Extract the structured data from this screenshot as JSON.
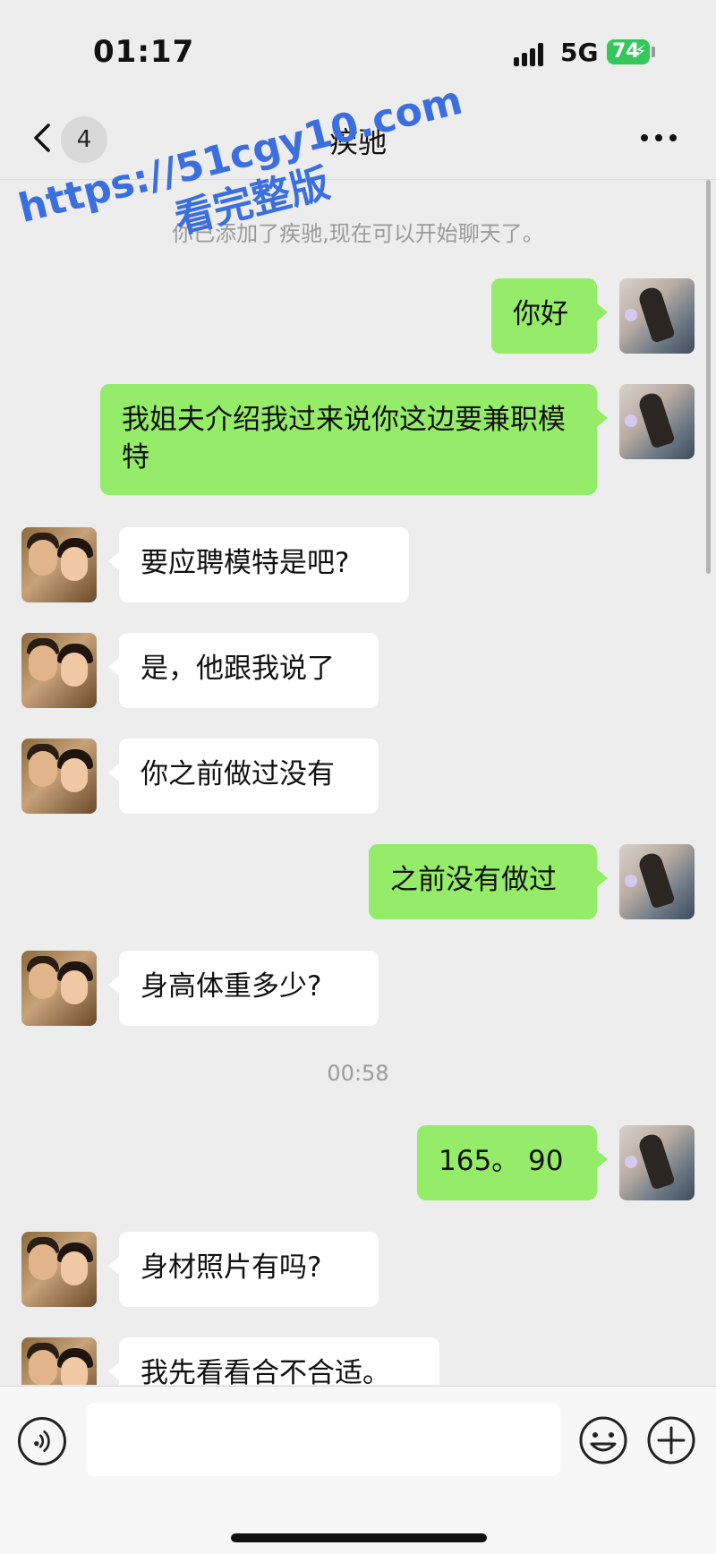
{
  "status_bar": {
    "time": "01:17",
    "network": "5G",
    "battery": "74"
  },
  "header": {
    "back_icon": "chevron-left-icon",
    "unread_count": "4",
    "title": "疾驰",
    "more_icon": "more-dots-icon"
  },
  "chat": {
    "system_message": "你已添加了疾驰,现在可以开始聊天了。",
    "timestamp": "00:58",
    "messages": [
      {
        "sender": "me",
        "text": "你好"
      },
      {
        "sender": "me",
        "text": "我姐夫介绍我过来说你这边要兼职模特"
      },
      {
        "sender": "other",
        "text": "要应聘模特是吧?"
      },
      {
        "sender": "other",
        "text": "是，他跟我说了"
      },
      {
        "sender": "other",
        "text": "你之前做过没有"
      },
      {
        "sender": "me",
        "text": "之前没有做过"
      },
      {
        "sender": "other",
        "text": "身高体重多少?"
      },
      {
        "sender": "me",
        "text": "165。 90"
      },
      {
        "sender": "other",
        "text": "身材照片有吗?"
      },
      {
        "sender": "other",
        "text": "我先看看合不合适。"
      }
    ]
  },
  "watermark": {
    "line1": "https://51cgy10.com",
    "line2": "看完整版"
  },
  "input_bar": {
    "voice_icon": "voice-icon",
    "input_value": "",
    "emoji_icon": "emoji-icon",
    "plus_icon": "plus-icon"
  },
  "colors": {
    "my_bubble": "#95ec69",
    "other_bubble": "#ffffff",
    "background": "#ededed",
    "battery": "#34c759",
    "watermark": "#3b6fe0"
  }
}
